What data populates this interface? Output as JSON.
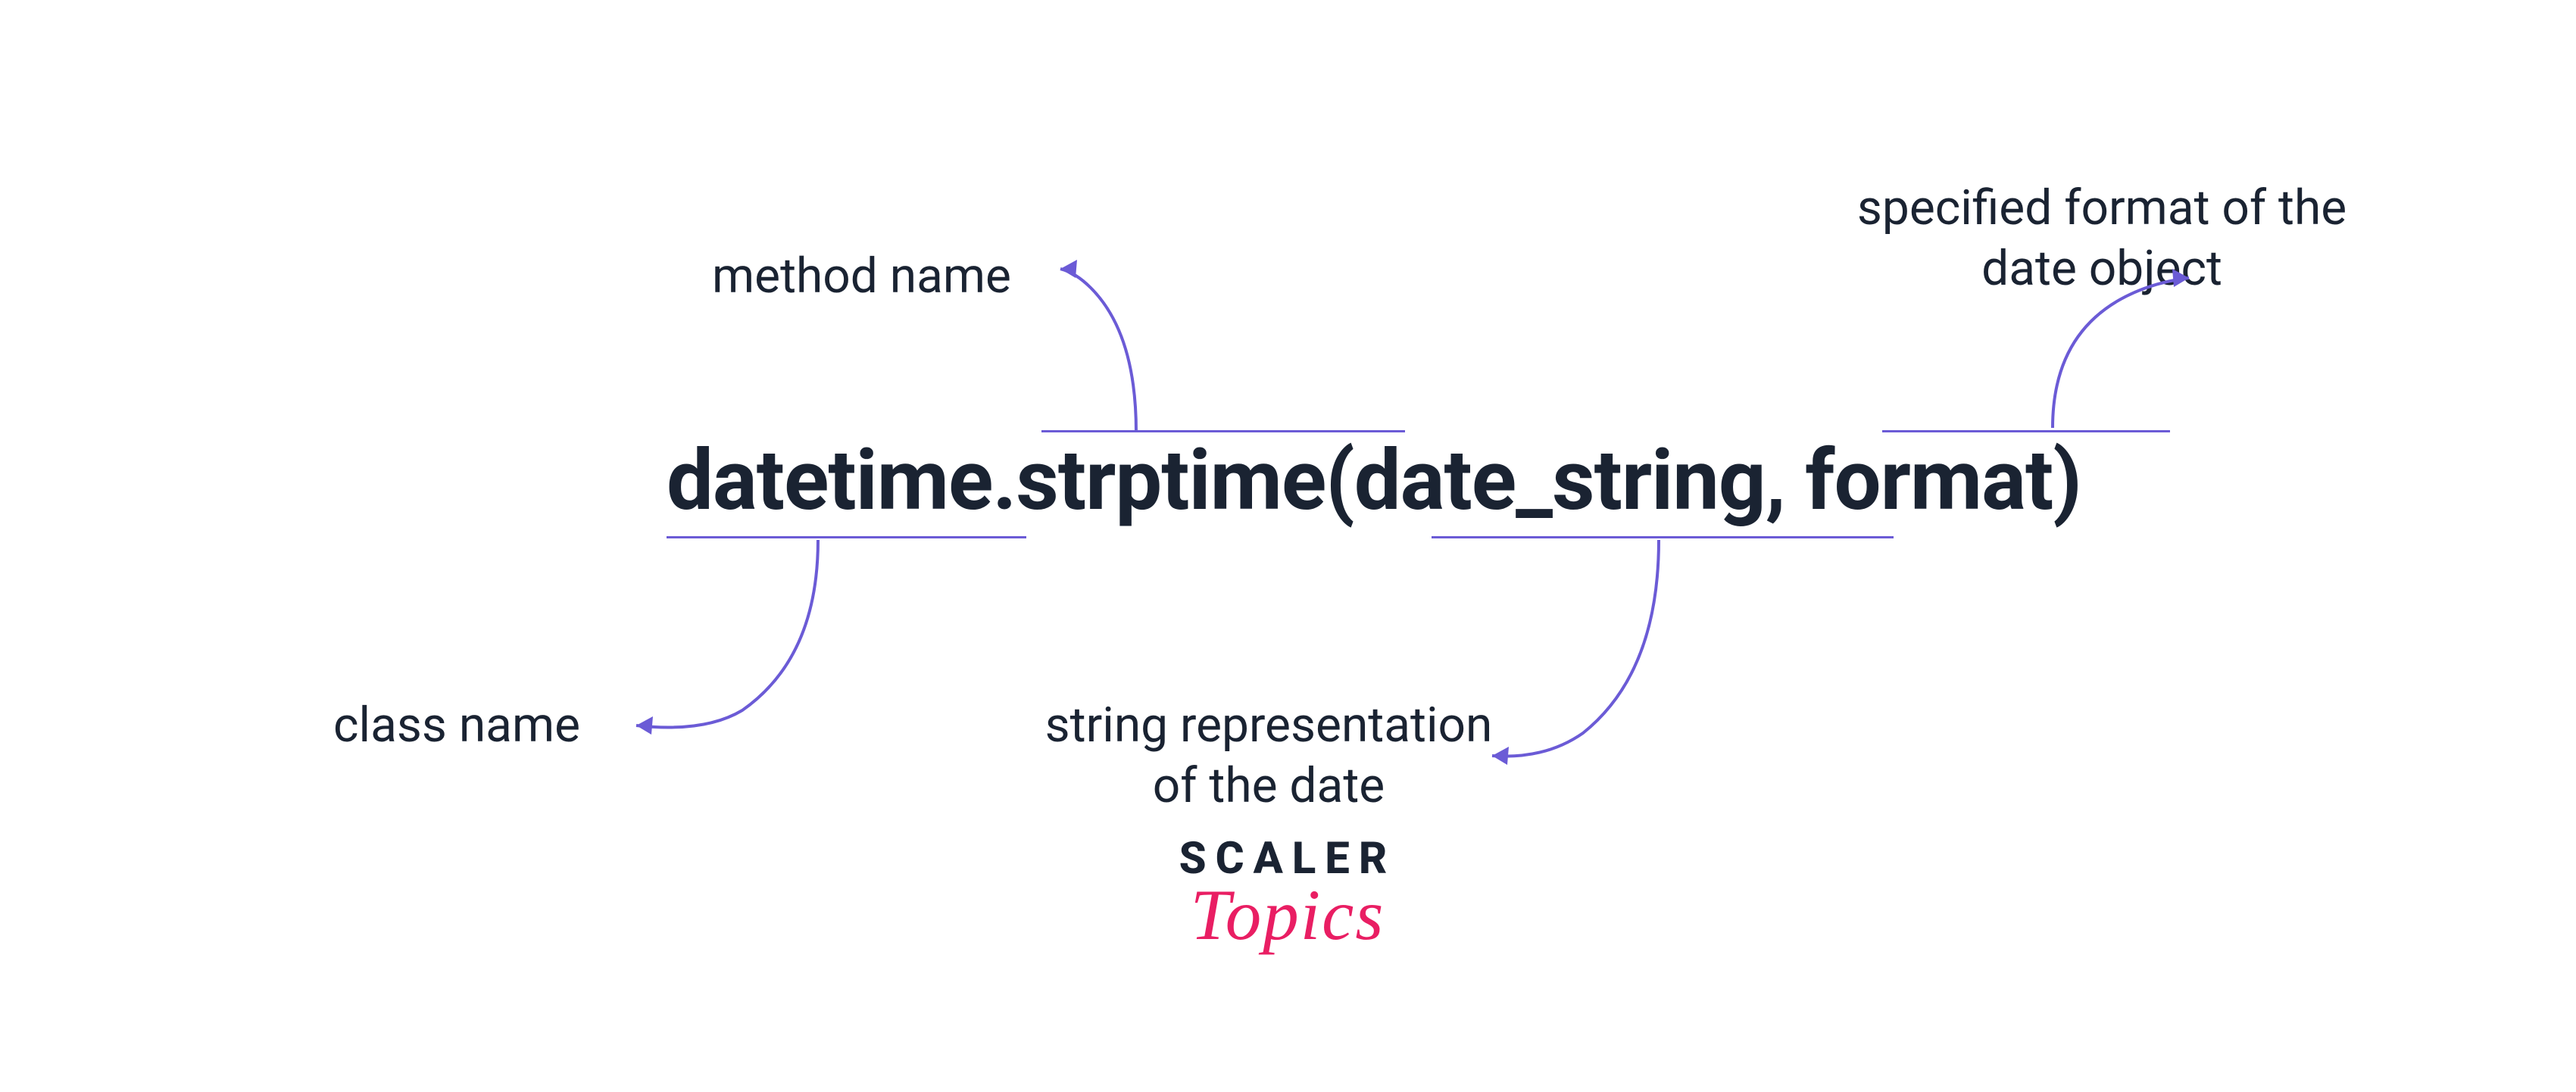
{
  "code": {
    "class_name": "datetime",
    "dot": ".",
    "method_name": "strptime",
    "paren_open": "(",
    "arg1": "date_string",
    "comma": ", ",
    "arg2": "format",
    "paren_close": ")"
  },
  "annotations": {
    "class_label": "class name",
    "method_label": "method name",
    "arg1_label_line1": "string representation",
    "arg1_label_line2": "of the date",
    "arg2_label_line1": "specified format of the",
    "arg2_label_line2": "date object"
  },
  "logo": {
    "brand": "SCALER",
    "sub": "Topics"
  }
}
